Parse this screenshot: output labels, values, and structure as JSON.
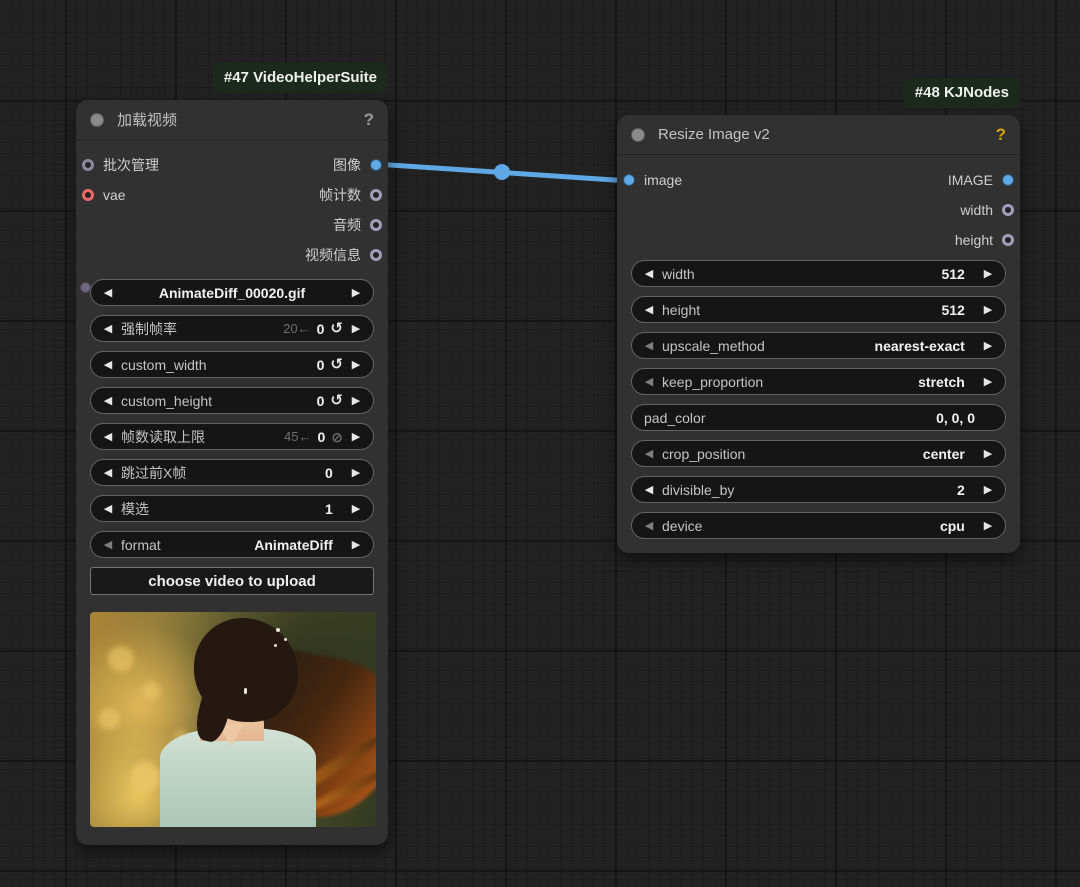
{
  "glyphs": {
    "left_arrow": "◀",
    "right_arrow": "▶",
    "refresh": "↺",
    "no_entry": "⊘",
    "help": "?"
  },
  "colors": {
    "link_blue": "#5fa8e6",
    "slot_vae_red": "#f16a6a",
    "slot_gray": "#8b88a0",
    "badge_bg": "#1c2a1d",
    "help_gold": "#d9a406"
  },
  "nodes": {
    "load_video": {
      "badge": "#47 VideoHelperSuite",
      "title": "加载视频",
      "inputs": [
        {
          "label": "批次管理"
        },
        {
          "label": "vae"
        }
      ],
      "outputs": [
        {
          "label": "图像"
        },
        {
          "label": "帧计数"
        },
        {
          "label": "音频"
        },
        {
          "label": "视频信息"
        }
      ],
      "widgets": [
        {
          "value": "AnimateDiff_00020.gif"
        },
        {
          "label": "强制帧率",
          "hint": "20←",
          "value": "0"
        },
        {
          "label": "custom_width",
          "value": "0"
        },
        {
          "label": "custom_height",
          "value": "0"
        },
        {
          "label": "帧数读取上限",
          "hint": "45←",
          "value": "0"
        },
        {
          "label": "跳过前X帧",
          "value": "0"
        },
        {
          "label": "模选",
          "value": "1"
        },
        {
          "label": "format",
          "value": "AnimateDiff"
        }
      ],
      "upload_button": "choose video to upload"
    },
    "resize_image": {
      "badge": "#48 KJNodes",
      "title": "Resize Image v2",
      "inputs": [
        {
          "label": "image"
        }
      ],
      "outputs": [
        {
          "label": "IMAGE"
        },
        {
          "label": "width"
        },
        {
          "label": "height"
        }
      ],
      "widgets": [
        {
          "label": "width",
          "value": "512"
        },
        {
          "label": "height",
          "value": "512"
        },
        {
          "label": "upscale_method",
          "value": "nearest-exact"
        },
        {
          "label": "keep_proportion",
          "value": "stretch"
        },
        {
          "label": "pad_color",
          "value": "0, 0, 0"
        },
        {
          "label": "crop_position",
          "value": "center"
        },
        {
          "label": "divisible_by",
          "value": "2"
        },
        {
          "label": "device",
          "value": "cpu"
        }
      ]
    }
  }
}
